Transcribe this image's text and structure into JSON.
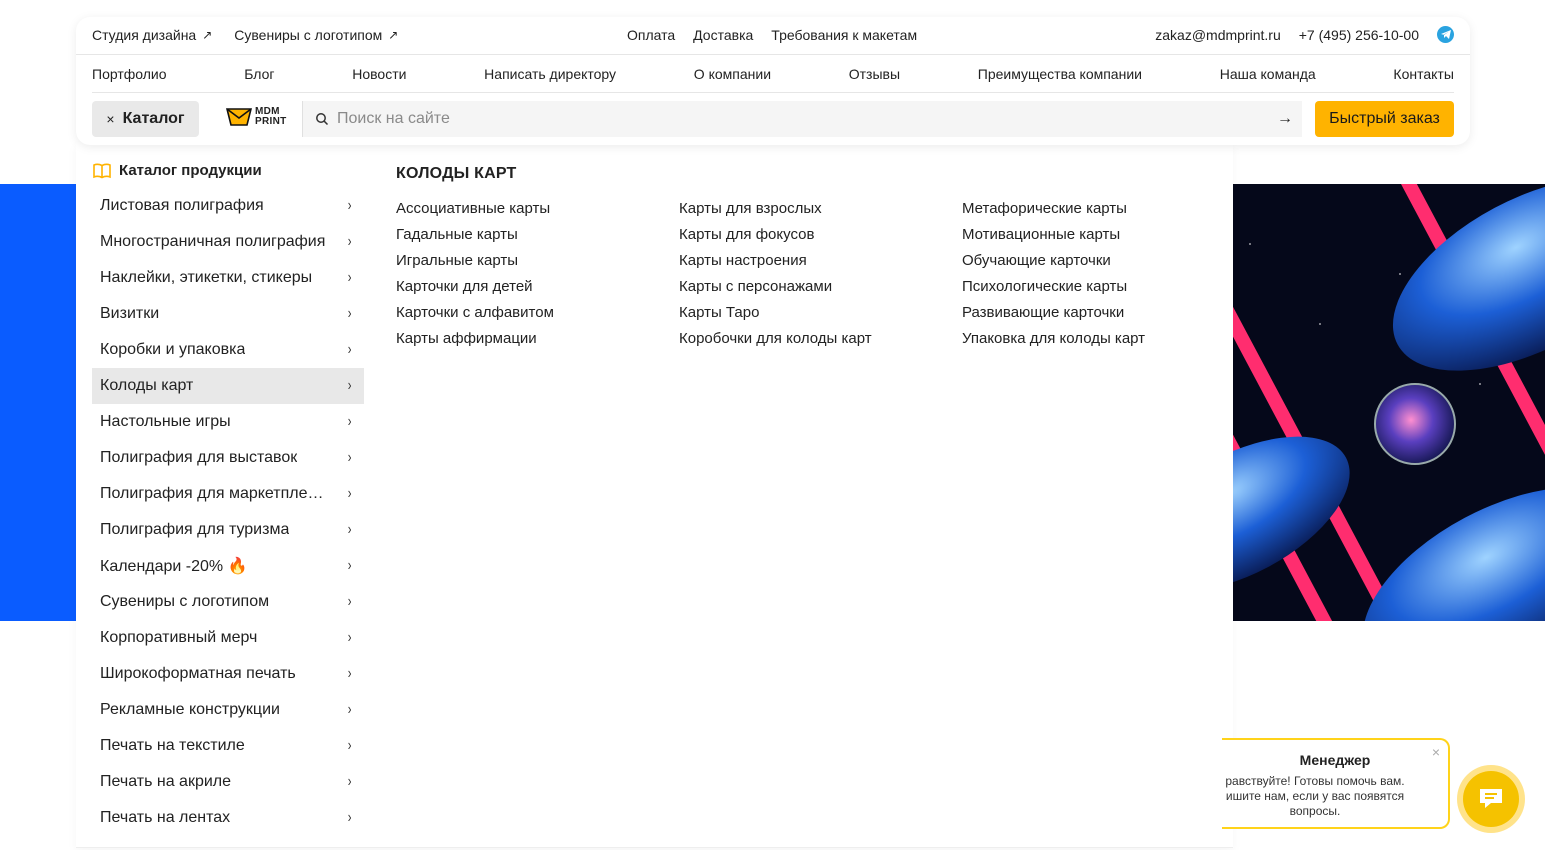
{
  "topbar": {
    "left_links": [
      {
        "label": "Студия дизайна"
      },
      {
        "label": "Сувениры с логотипом"
      }
    ],
    "center_links": [
      "Оплата",
      "Доставка",
      "Требования к макетам"
    ],
    "email": "zakaz@mdmprint.ru",
    "phone": "+7 (495) 256-10-00"
  },
  "nav": [
    "Портфолио",
    "Блог",
    "Новости",
    "Написать директору",
    "О компании",
    "Отзывы",
    "Преимущества компании",
    "Наша команда",
    "Контакты"
  ],
  "catalog_button": {
    "label": "Каталог",
    "close_symbol": "×"
  },
  "logo": {
    "line1": "MDM",
    "line2": "PRINT"
  },
  "search": {
    "placeholder": "Поиск на сайте",
    "submit_symbol": "→"
  },
  "quick_order": "Быстрый заказ",
  "catalog": {
    "heading": "Каталог продукции",
    "items": [
      "Листовая полиграфия",
      "Многостраничная полиграфия",
      "Наклейки, этикетки, стикеры",
      "Визитки",
      "Коробки и упаковка",
      "Колоды карт",
      "Настольные игры",
      "Полиграфия для выставок",
      "Полиграфия для маркетплейсов",
      "Полиграфия для туризма",
      "Календари -20% 🔥",
      "Сувениры с логотипом",
      "Корпоративный мерч",
      "Широкоформатная печать",
      "Рекламные конструкции",
      "Печать на текстиле",
      "Печать на акриле",
      "Печать на лентах"
    ],
    "active_index": 5
  },
  "submenu": {
    "title": "КОЛОДЫ КАРТ",
    "columns": [
      [
        "Ассоциативные карты",
        "Гадальные карты",
        "Игральные карты",
        "Карточки для детей",
        "Карточки с алфавитом",
        "Карты аффирмации"
      ],
      [
        "Карты для взрослых",
        "Карты для фокусов",
        "Карты настроения",
        "Карты с персонажами",
        "Карты Таро",
        "Коробочки для колоды карт"
      ],
      [
        "Метафорические карты",
        "Мотивационные карты",
        "Обучающие карточки",
        "Психологические карты",
        "Развивающие карточки",
        "Упаковка для колоды карт"
      ]
    ]
  },
  "chat": {
    "title": "Менеджер",
    "message": "равствуйте! Готовы помочь вам.\nишите нам, если у вас появятся\nвопросы.",
    "close_symbol": "×"
  },
  "colors": {
    "accent": "#ffb300",
    "hero_blue": "#0a5cff",
    "telegram": "#2aa3e0",
    "chat_border": "#ffd31a"
  }
}
